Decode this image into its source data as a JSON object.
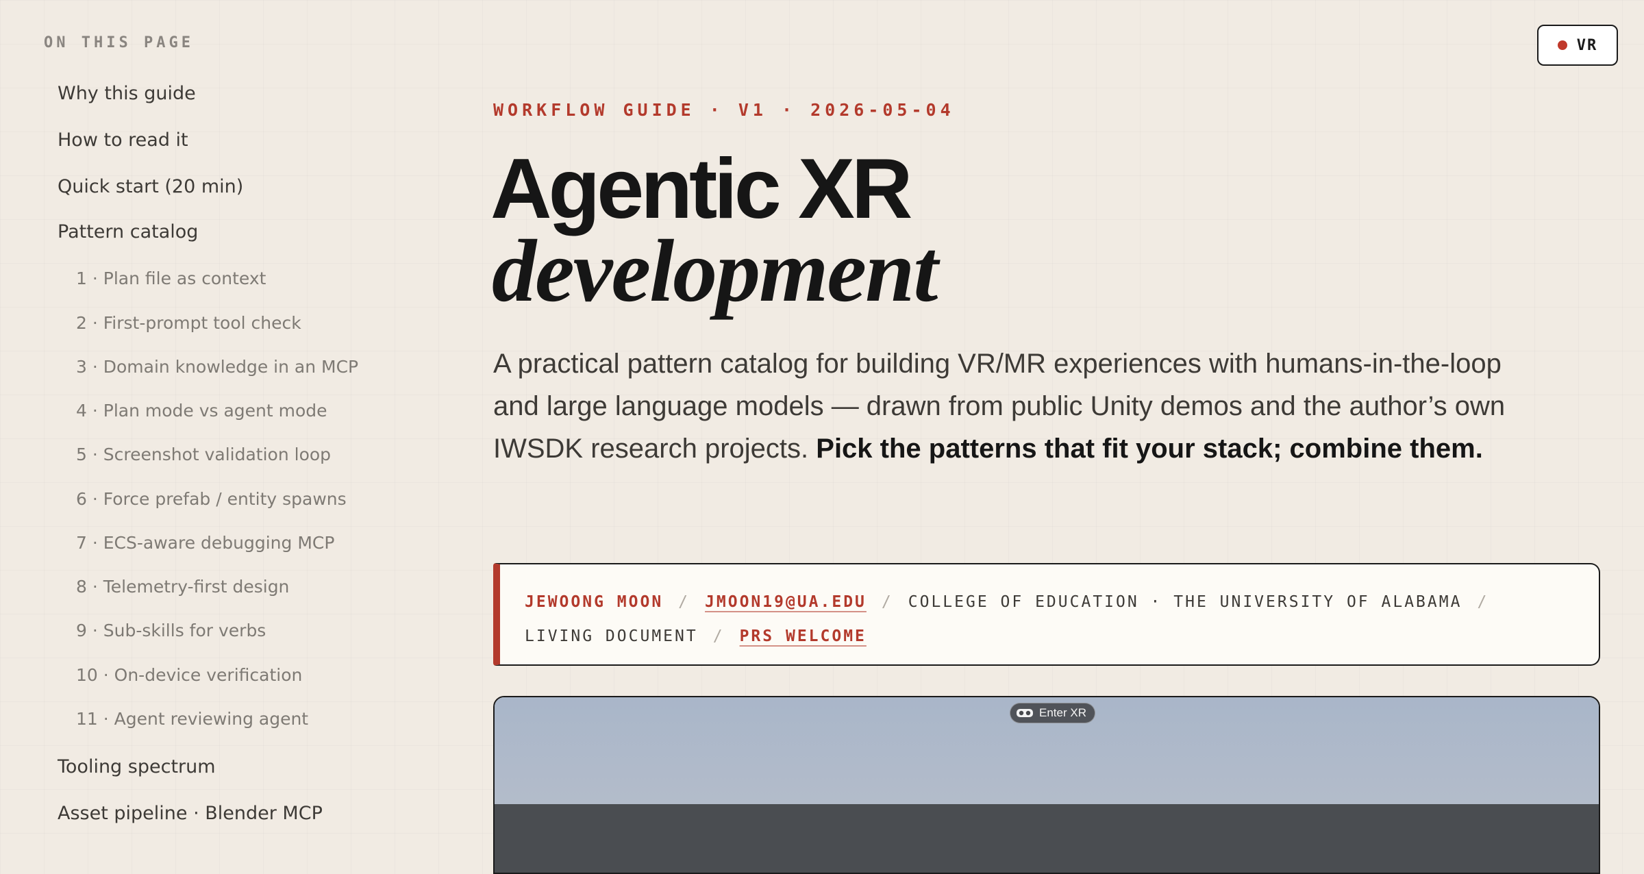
{
  "sidebar": {
    "heading": "ON THIS PAGE",
    "items": [
      {
        "label": "Why this guide"
      },
      {
        "label": "How to read it"
      },
      {
        "label": "Quick start (20 min)"
      },
      {
        "label": "Pattern catalog"
      },
      {
        "label": "1 · Plan file as context"
      },
      {
        "label": "2 · First-prompt tool check"
      },
      {
        "label": "3 · Domain knowledge in an MCP"
      },
      {
        "label": "4 · Plan mode vs agent mode"
      },
      {
        "label": "5 · Screenshot validation loop"
      },
      {
        "label": "6 · Force prefab / entity spawns"
      },
      {
        "label": "7 · ECS-aware debugging MCP"
      },
      {
        "label": "8 · Telemetry-first design"
      },
      {
        "label": "9 · Sub-skills for verbs"
      },
      {
        "label": "10 · On-device verification"
      },
      {
        "label": "11 · Agent reviewing agent"
      },
      {
        "label": "Tooling spectrum"
      },
      {
        "label": "Asset pipeline · Blender MCP"
      }
    ]
  },
  "vr_button": {
    "label": "VR"
  },
  "hero": {
    "eyebrow": "WORKFLOW GUIDE · V1 · 2026-05-04",
    "title_line1": "Agentic XR",
    "title_line2": "development",
    "lede": "A practical pattern catalog for building VR/MR experiences with humans-in-the-loop and large language models — drawn from public Unity demos and the author’s own IWSDK research projects.",
    "lede_emphasis": "Pick the patterns that fit your stack; combine them."
  },
  "meta": {
    "author": "JEWOONG MOON",
    "email": "JMOON19@UA.EDU",
    "affiliation": "COLLEGE OF EDUCATION · THE UNIVERSITY OF ALABAMA",
    "status": "LIVING DOCUMENT",
    "prs": "PRS WELCOME",
    "separator": "/"
  },
  "scene": {
    "enter_xr_label": "Enter XR"
  },
  "colors": {
    "accent": "#b33a2c",
    "background": "#f1ebe3",
    "ink": "#161616"
  }
}
